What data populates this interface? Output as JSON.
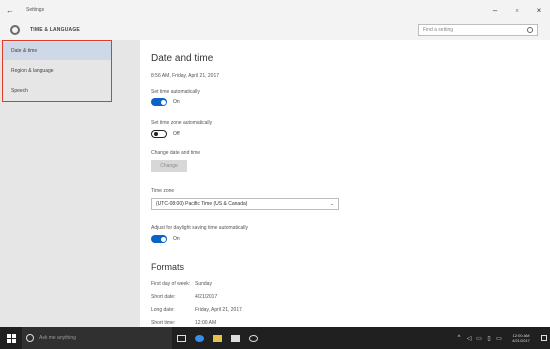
{
  "titlebar": {
    "back_glyph": "←",
    "title": "Settings",
    "minimize_glyph": "–",
    "maximize_glyph": "▫",
    "close_glyph": "×"
  },
  "header": {
    "icon": "gear-icon",
    "title": "TIME & LANGUAGE",
    "search_placeholder": "Find a setting"
  },
  "sidebar": {
    "items": [
      {
        "label": "Date & time",
        "active": true
      },
      {
        "label": "Region & language",
        "active": false
      },
      {
        "label": "Speech",
        "active": false
      }
    ]
  },
  "main": {
    "heading": "Date and time",
    "current_datetime": "8:56 AM, Friday, April 21, 2017",
    "set_time_auto": {
      "label": "Set time automatically",
      "state": "On",
      "on": true
    },
    "set_tz_auto": {
      "label": "Set time zone automatically",
      "state": "Off",
      "on": false
    },
    "change_label": "Change date and time",
    "change_button": "Change",
    "timezone": {
      "label": "Time zone",
      "value": "(UTC-08:00) Pacific Time (US & Canada)"
    },
    "dst": {
      "label": "Adjust for daylight saving time automatically",
      "state": "On",
      "on": true
    },
    "formats_heading": "Formats",
    "formats": [
      {
        "key": "First day of week:",
        "value": "Sunday"
      },
      {
        "key": "Short date:",
        "value": "4/21/2017"
      },
      {
        "key": "Long date:",
        "value": "Friday, April 21, 2017"
      },
      {
        "key": "Short time:",
        "value": "12:00 AM"
      }
    ]
  },
  "taskbar": {
    "search_placeholder": "Ask me anything",
    "clock_time": "12:00 AM",
    "clock_date": "4/21/2017",
    "colors": {
      "taskbar_bg": "#202020",
      "accent": "#0a64c8"
    }
  }
}
